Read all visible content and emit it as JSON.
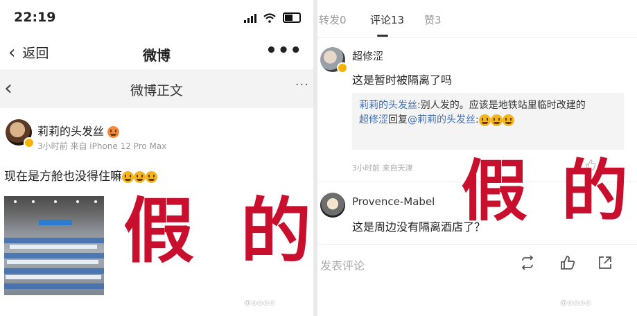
{
  "left": {
    "status": {
      "time": "22:19"
    },
    "nav": {
      "back_label": "返回",
      "title": "微博",
      "more": "•••"
    },
    "subnav": {
      "title": "微博正文",
      "more": "···"
    },
    "post": {
      "username": "莉莉的头发丝",
      "meta": "3小时前 来自 iPhone 12 Pro Max",
      "content": "现在是方舱也没得住嘛"
    }
  },
  "overlay": {
    "char1": "假",
    "char2": "的",
    "char3": "假",
    "char4": "的"
  },
  "right": {
    "tabs": [
      {
        "label": "转发0"
      },
      {
        "label": "评论13"
      },
      {
        "label": "赞3"
      }
    ],
    "comment1": {
      "username": "超修涩",
      "text": "这是暂时被隔离了吗",
      "reply1_user": "莉莉的头发丝",
      "reply1_text": ":别人发的。应该是地铁站里临时改建的",
      "reply2_user": "超修涩",
      "reply2_mid": "回复",
      "reply2_at": "@莉莉的头发丝",
      "reply2_tail": ":",
      "meta": "3小时前 来自天津"
    },
    "comment2": {
      "username": "Provence-Mabel",
      "text": "这是周边没有隔离酒店了？"
    },
    "bottom": {
      "placeholder": "发表评论"
    }
  },
  "colors": {
    "overlay_red": "#c8102e",
    "link_blue": "#3f6fb6"
  },
  "icons": [
    "chevron-left-icon",
    "wifi-icon",
    "battery-icon",
    "signal-icon",
    "repost-icon",
    "like-icon",
    "share-icon",
    "more-icon"
  ]
}
